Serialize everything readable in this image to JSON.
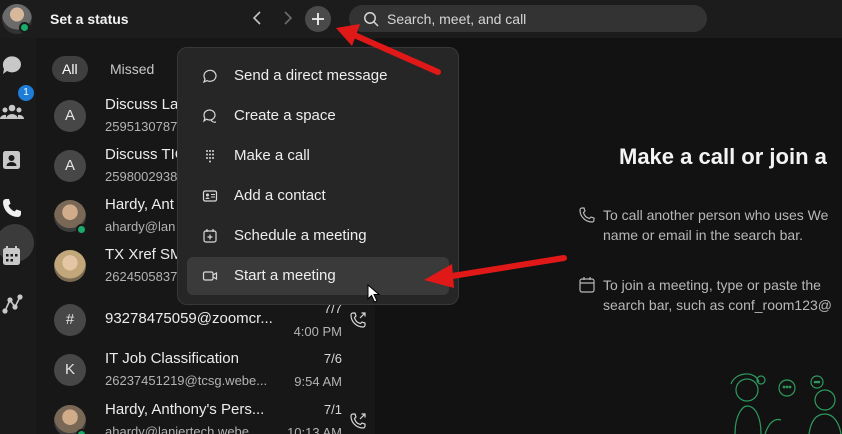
{
  "header": {
    "status_label": "Set a status",
    "search_placeholder": "Search, meet, and call"
  },
  "rail": {
    "messaging_badge": "1"
  },
  "filters": [
    {
      "label": "All",
      "active": true
    },
    {
      "label": "Missed",
      "active": false
    }
  ],
  "contacts": [
    {
      "initial": "A",
      "name": "Discuss La",
      "sub": "2595130787",
      "date": "",
      "time": ""
    },
    {
      "initial": "A",
      "name": "Discuss TIC",
      "sub": "2598002938",
      "date": "",
      "time": ""
    },
    {
      "initial": "",
      "name": "Hardy, Ant",
      "sub": "ahardy@lan",
      "date": "",
      "time": ""
    },
    {
      "initial": "",
      "name": "TX Xref SM",
      "sub": "2624505837",
      "date": "",
      "time": ""
    },
    {
      "initial": "#",
      "name": "93278475059@zoomcr...",
      "sub": "",
      "date": "7/7",
      "time": "4:00 PM"
    },
    {
      "initial": "K",
      "name": "IT Job Classification",
      "sub": "26237451219@tcsg.webe...",
      "date": "7/6",
      "time": "9:54 AM"
    },
    {
      "initial": "",
      "name": "Hardy, Anthony's Pers...",
      "sub": "ahardy@laniertech.webe...",
      "date": "7/1",
      "time": "10:13 AM"
    }
  ],
  "menu": {
    "items": [
      {
        "label": "Send a direct message",
        "icon": "chat-bubble-icon"
      },
      {
        "label": "Create a space",
        "icon": "space-icon"
      },
      {
        "label": "Make a call",
        "icon": "dialpad-icon"
      },
      {
        "label": "Add a contact",
        "icon": "contact-card-icon"
      },
      {
        "label": "Schedule a meeting",
        "icon": "calendar-plus-icon"
      },
      {
        "label": "Start a meeting",
        "icon": "video-camera-icon"
      }
    ],
    "hovered_index": 5
  },
  "main": {
    "hero_title": "Make a call or join a",
    "tip_call_line1": "To call another person who uses We",
    "tip_call_line2": "name or email in the search bar.",
    "tip_meeting_line1": "To join a meeting, type or paste the",
    "tip_meeting_line2": "search bar, such as conf_room123@"
  },
  "colors": {
    "accent_green": "#1aaa6a",
    "badge_blue": "#1d7dd8",
    "annotation_red": "#e01818"
  }
}
